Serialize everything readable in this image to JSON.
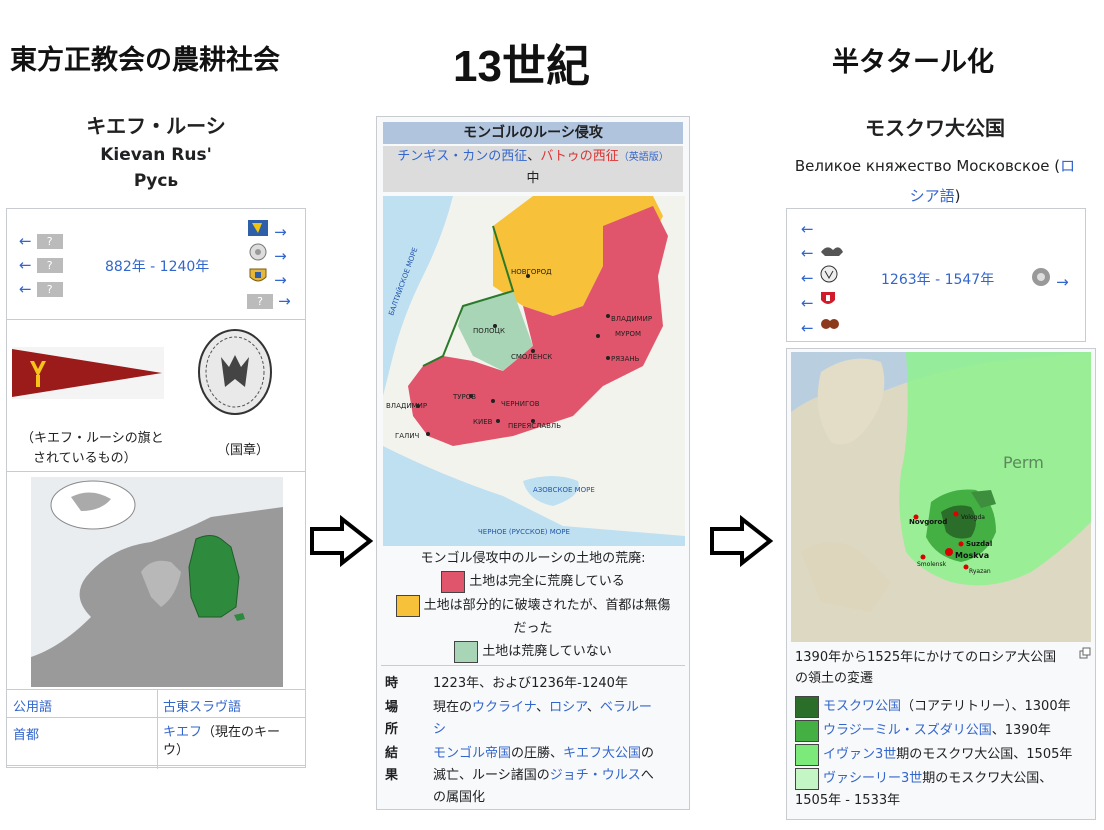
{
  "headings": {
    "left": "東方正教会の農耕社会",
    "center": "13世紀",
    "right": "半タタール化"
  },
  "left_box": {
    "title_jp": "キエフ・ルーシ",
    "title_en": "Kievan Rus'",
    "title_ru": "Русь",
    "arrow": "←",
    "arrow_right": "→",
    "q": "?",
    "years": "882年 - 1240年",
    "flag_caption_1": "（キエフ・ルーシの旗と",
    "flag_caption_2": "されているもの）",
    "seal_caption": "（国章）",
    "rows": [
      {
        "label": "公用語",
        "value": "古東スラヴ語"
      },
      {
        "label": "首都",
        "value_link": "キエフ",
        "value_rest": "（現在のキー",
        "value_rest2": "ウ）"
      }
    ]
  },
  "center_box": {
    "title": "モンゴルのルーシ侵攻",
    "sub_link1": "チンギス・カンの西征",
    "sub_sep": "、",
    "sub_link2": "バトゥの西征",
    "sub_lang": "（英語版）",
    "sub_result": "中",
    "map_labels": {
      "novgorod": "НОВГОРОД",
      "polotsk": "ПОЛОЦК",
      "smolensk": "СМОЛЕНСК",
      "vladimir_e": "ВЛАДИМИР",
      "murom": "МУРОМ",
      "ryazan": "РЯЗАНЬ",
      "chernigov": "ЧЕРНИГОВ",
      "turov": "ТУРОВ",
      "kiev": "КИЕВ",
      "pereyaslavl": "ПЕРЕЯСЛАВЛЬ",
      "vladimir_w": "ВЛАДИМИР",
      "galich": "ГАЛИЧ",
      "azov": "АЗОВСКОЕ МОРЕ",
      "black": "ЧЕРНОЕ (РУССКОЕ) МОРЕ",
      "baltic": "БАЛТИЙСКОЕ МОРЕ"
    },
    "legend_title": "モンゴル侵攻中のルーシの土地の荒廃:",
    "legend": [
      {
        "color": "#e0556b",
        "text": "土地は完全に荒廃している"
      },
      {
        "color": "#f7c23a",
        "text": "土地は部分的に破壊されたが、首都は無傷",
        "text2": "だった"
      },
      {
        "color": "#a8d5b5",
        "text": "土地は荒廃していない"
      }
    ],
    "info": {
      "time_label": "時",
      "time_value": "1223年、および1236年-1240年",
      "place_label": "場所",
      "place_prefix": "現在の",
      "place_l1": "ウクライナ",
      "place_sep": "、",
      "place_l2": "ロシア",
      "place_l3": "ベラルー",
      "place_l3b": "シ",
      "result_label": "結果",
      "result_l1": "モンゴル帝国",
      "result_t1": "の圧勝、",
      "result_l2": "キエフ大公国",
      "result_t2": "の",
      "result_t3": "滅亡、ルーシ諸国の",
      "result_l3": "ジョチ・ウルス",
      "result_t4": "へ",
      "result_t5": "の属国化"
    }
  },
  "right_box": {
    "title_jp": "モスクワ大公国",
    "title_ru": "Великое княжество Московское",
    "lang_open": "(",
    "lang_link1": "ロ",
    "lang_link2": "シア語",
    "lang_close": ")",
    "arrow": "←",
    "arrow_right": "→",
    "years": "1263年 - 1547年",
    "map_labels": {
      "perm": "Perm",
      "novgorod": "Novgorod",
      "vologda": "Vologda",
      "suzdal": "Suzdal",
      "moskva": "Moskva",
      "smolensk": "Smolensk",
      "ryazan": "Ryazan"
    },
    "caption_1": "1390年から1525年にかけてのロシア大公国",
    "caption_2": "の領土の変遷",
    "legend": [
      {
        "color": "#2a6e2a",
        "link": "モスクワ公国",
        "rest": "（コアテリトリー）、1300年"
      },
      {
        "color": "#44b044",
        "link": "ウラジーミル・スズダリ公国",
        "rest": "、1390年"
      },
      {
        "color": "#7bea7b",
        "link": "イヴァン3世",
        "rest": "期のモスクワ大公国、1505年"
      },
      {
        "color": "#c4f5c4",
        "link": "ヴァシーリー3世",
        "rest": "期のモスクワ大公国、",
        "rest2": "1505年 - 1533年"
      }
    ]
  }
}
